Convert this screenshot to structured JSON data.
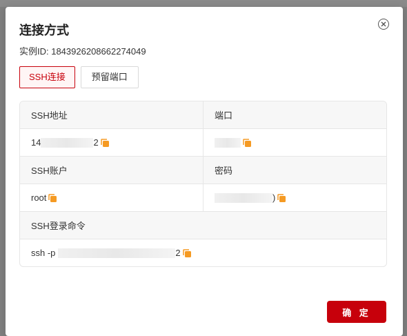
{
  "dialog": {
    "title": "连接方式",
    "instance_label": "实例ID: 1843926208662274049",
    "tabs": [
      {
        "label": "SSH连接",
        "active": true
      },
      {
        "label": "预留端口",
        "active": false
      }
    ],
    "fields": {
      "ssh_address": {
        "label": "SSH地址",
        "value_start": "14",
        "value_end": "2"
      },
      "port": {
        "label": "端口",
        "value_start": "",
        "value_end": ""
      },
      "ssh_account": {
        "label": "SSH账户",
        "value": "root"
      },
      "password": {
        "label": "密码",
        "value_start": "",
        "value_end": ")"
      },
      "ssh_command": {
        "label": "SSH登录命令",
        "value_start": "ssh -p",
        "value_end": "2"
      }
    },
    "ok_label": "确 定"
  },
  "colors": {
    "accent": "#c7000b",
    "copy_icon": "#f59a23"
  }
}
